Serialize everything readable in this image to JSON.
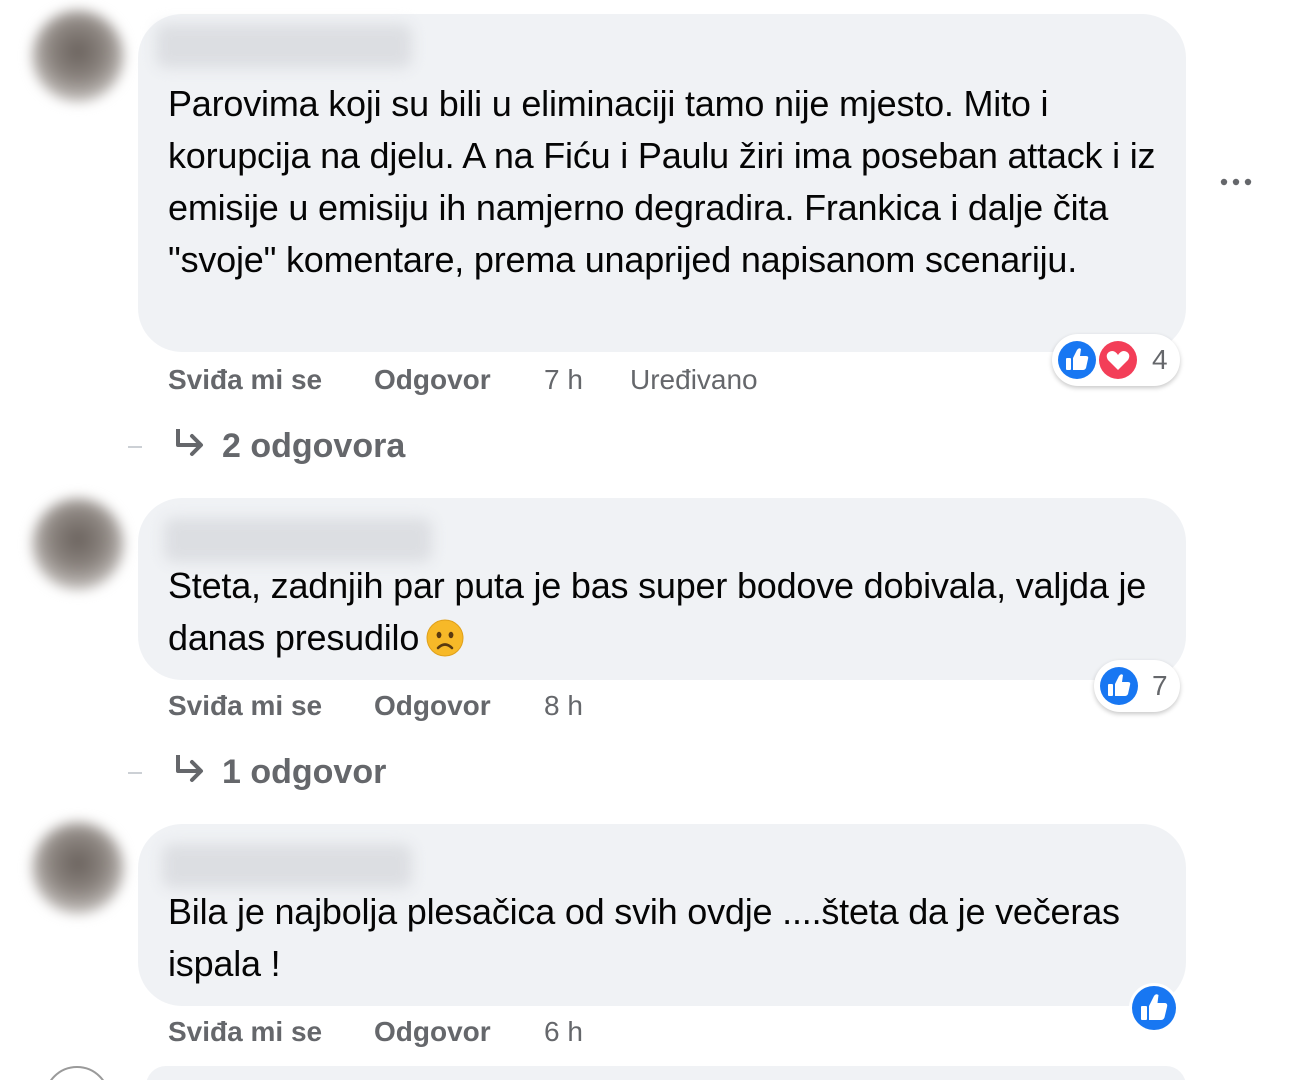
{
  "comments": [
    {
      "text": "Parovima koji su bili u eliminaciji tamo nije mjesto. Mito i korupcija na djelu. A na Fiću i Paulu žiri ima poseban attack i iz emisije u emisiju ih namjerno degradira. Frankica i dalje čita \"svoje\" komentare, prema unaprijed napisanom scenariju.",
      "like_label": "Sviđa mi se",
      "reply_label": "Odgovor",
      "time": "7 h",
      "edited_label": "Uređivano",
      "reaction_count": "4",
      "reaction_icons": [
        "like-icon",
        "love-icon"
      ],
      "replies_label": "2 odgovora"
    },
    {
      "text": "Steta, zadnjih par puta je bas super bodove dobivala, valjda je danas presudilo",
      "emoji": "frowning-face-emoji",
      "like_label": "Sviđa mi se",
      "reply_label": "Odgovor",
      "time": "8 h",
      "reaction_count": "7",
      "reaction_icons": [
        "like-icon"
      ],
      "replies_label": "1 odgovor"
    },
    {
      "text": "Bila je najbolja plesačica od svih ovdje ....šteta da je večeras ispala !",
      "like_label": "Sviđa mi se",
      "reply_label": "Odgovor",
      "time": "6 h",
      "reaction_icons": [
        "like-icon"
      ]
    }
  ],
  "colors": {
    "bubble": "#f0f2f5",
    "text": "#050505",
    "secondary_text": "#65676b",
    "like_blue": "#1877f2",
    "love_red": "#f33e58"
  }
}
